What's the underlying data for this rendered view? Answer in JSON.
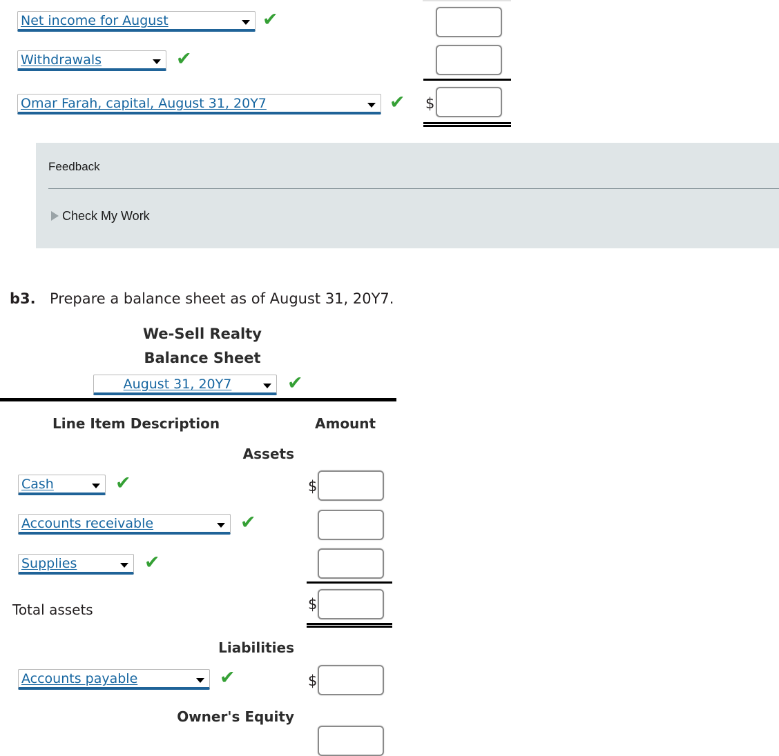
{
  "statement_of_equity": {
    "rows": [
      {
        "select_value": "Net income for August",
        "check": "✔",
        "has_dollar": false
      },
      {
        "select_value": "Withdrawals",
        "check": "✔",
        "has_dollar": false
      },
      {
        "select_value": "Omar Farah, capital, August 31, 20Y7",
        "check": "✔",
        "has_dollar": true,
        "dollar": "$"
      }
    ]
  },
  "feedback": {
    "title": "Feedback",
    "check_my_work_label": "Check My Work"
  },
  "question": {
    "number": "b3.",
    "prompt": "Prepare a balance sheet as of August 31, 20Y7."
  },
  "balance_sheet": {
    "company": "We-Sell Realty",
    "statement": "Balance Sheet",
    "date_select_value": "August 31, 20Y7",
    "date_check": "✔",
    "headers": {
      "description": "Line Item Description",
      "amount": "Amount"
    },
    "sections": {
      "assets": "Assets",
      "liabilities": "Liabilities",
      "owners_equity": "Owner's Equity"
    },
    "asset_rows": [
      {
        "select_value": "Cash",
        "check": "✔",
        "has_dollar": true,
        "dollar": "$"
      },
      {
        "select_value": "Accounts receivable",
        "check": "✔",
        "has_dollar": false
      },
      {
        "select_value": "Supplies",
        "check": "✔",
        "has_dollar": false
      }
    ],
    "total_assets": {
      "label": "Total assets",
      "dollar": "$"
    },
    "liability_rows": [
      {
        "select_value": "Accounts payable",
        "check": "✔",
        "has_dollar": true,
        "dollar": "$"
      }
    ]
  },
  "colors": {
    "select_text": "#1565a0",
    "select_underline": "#1f6398",
    "check_green": "#35a035",
    "feedback_bg": "#dfe5e7",
    "rule_black": "#000000"
  }
}
